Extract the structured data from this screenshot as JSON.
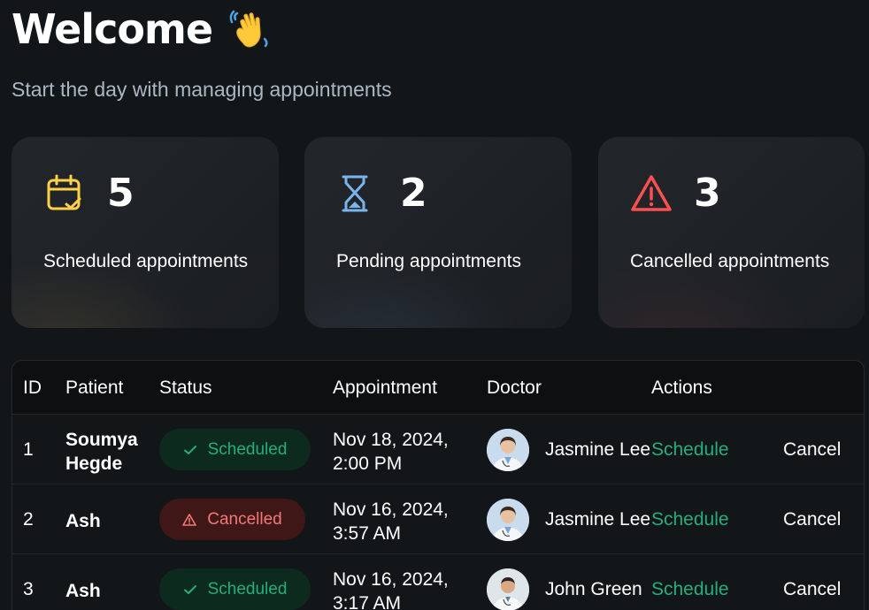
{
  "header": {
    "title": "Welcome",
    "wave_icon": "waving-hand-icon",
    "subtitle": "Start the day with managing appointments"
  },
  "stats": [
    {
      "count": "5",
      "label": "Scheduled appointments",
      "icon": "calendar-check-icon",
      "color": "#ffd147"
    },
    {
      "count": "2",
      "label": "Pending appointments",
      "icon": "hourglass-icon",
      "color": "#79b5ec"
    },
    {
      "count": "3",
      "label": "Cancelled appointments",
      "icon": "warning-triangle-icon",
      "color": "#ff4f4e"
    }
  ],
  "table": {
    "headers": {
      "id": "ID",
      "patient": "Patient",
      "status": "Status",
      "appointment": "Appointment",
      "doctor": "Doctor",
      "actions": "Actions"
    },
    "rows": [
      {
        "id": "1",
        "patient": "Soumya Hegde",
        "status": "Scheduled",
        "appointment": "Nov 18, 2024, 2:00 PM",
        "doctor": "Jasmine Lee",
        "schedule": "Schedule",
        "cancel": "Cancel"
      },
      {
        "id": "2",
        "patient": "Ash",
        "status": "Cancelled",
        "appointment": "Nov 16, 2024, 3:57 AM",
        "doctor": "Jasmine Lee",
        "schedule": "Schedule",
        "cancel": "Cancel"
      },
      {
        "id": "3",
        "patient": "Ash",
        "status": "Scheduled",
        "appointment": "Nov 16, 2024, 3:17 AM",
        "doctor": "John Green",
        "schedule": "Schedule",
        "cancel": "Cancel"
      }
    ]
  },
  "colors": {
    "scheduled": "#24ae7c",
    "cancelled": "#f37877",
    "background": "#131619"
  }
}
